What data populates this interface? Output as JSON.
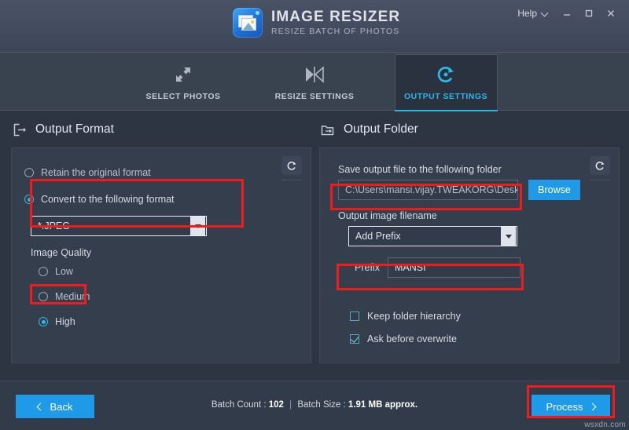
{
  "window": {
    "help_label": "Help",
    "help_chevron_icon": "chevron-down-icon",
    "minimize_icon": "minimize-icon",
    "maximize_icon": "maximize-icon",
    "close_icon": "close-icon"
  },
  "brand": {
    "logo_icon": "photos-stack-icon",
    "title": "IMAGE RESIZER",
    "subtitle": "RESIZE BATCH OF PHOTOS",
    "accent": "#1e9ae8"
  },
  "tabs": [
    {
      "label": "SELECT PHOTOS",
      "icon": "expand-arrows-icon",
      "active": false
    },
    {
      "label": "RESIZE SETTINGS",
      "icon": "resize-width-icon",
      "active": false
    },
    {
      "label": "OUTPUT SETTINGS",
      "icon": "refresh-circle-icon",
      "active": true
    }
  ],
  "active_tab_color": "#2ab8e8",
  "output_format": {
    "section_title": "Output Format",
    "section_icon": "export-box-icon",
    "reset_icon": "reset-undo-icon",
    "options": [
      {
        "label": "Retain the original format",
        "selected": false
      },
      {
        "label": "Convert to the following format",
        "selected": true
      }
    ],
    "format_select": {
      "value": "*.JPEG",
      "arrow_icon": "caret-down-icon"
    },
    "quality_label": "Image Quality",
    "quality_options": [
      {
        "label": "Low",
        "selected": false
      },
      {
        "label": "Medium",
        "selected": false
      },
      {
        "label": "High",
        "selected": true
      }
    ]
  },
  "output_folder": {
    "section_title": "Output Folder",
    "section_icon": "folder-export-icon",
    "reset_icon": "reset-undo-icon",
    "save_label": "Save output file to the following folder",
    "path_value": "C:\\Users\\mansi.vijay.TWEAKORG\\Desk...",
    "browse_label": "Browse",
    "filename_label": "Output image filename",
    "naming_select": {
      "value": "Add Prefix",
      "arrow_icon": "caret-down-icon"
    },
    "prefix_label": "Prefix",
    "prefix_value": "MANSI",
    "checkboxes": [
      {
        "label": "Keep folder hierarchy",
        "checked": false
      },
      {
        "label": "Ask before overwrite",
        "checked": true
      }
    ]
  },
  "footer": {
    "back_label": "Back",
    "back_icon": "chevron-left-icon",
    "process_label": "Process",
    "process_icon": "chevron-right-icon",
    "batch_count_label": "Batch Count :",
    "batch_count_value": "102",
    "separator": "|",
    "batch_size_label": "Batch Size :",
    "batch_size_value": "1.91 MB approx."
  },
  "annotations": {
    "highlight_color": "#f21b1b",
    "boxes": [
      "convert-format",
      "high-quality",
      "output-path",
      "prefix-field",
      "process-button"
    ]
  },
  "watermark": "wsxdn.com"
}
